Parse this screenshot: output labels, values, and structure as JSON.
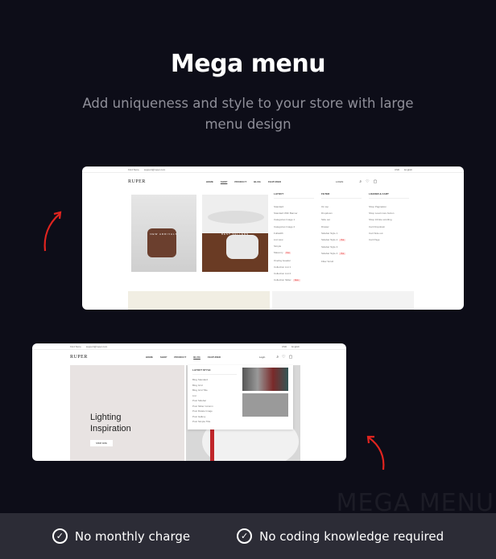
{
  "heading": {
    "title": "Mega menu",
    "subtitle": "Add uniqueness and style to your store with large menu design"
  },
  "watermark": "MEGA MENU",
  "features": [
    {
      "icon": "check-circle-icon",
      "label": "No monthly charge"
    },
    {
      "icon": "check-circle-icon",
      "label": "No coding knowledge required"
    }
  ],
  "shot1": {
    "topbar": {
      "store": "Find Store",
      "email": "support@ruper.com",
      "currency": "USD",
      "language": "English"
    },
    "logo": "RUPER",
    "nav": [
      "HOME",
      "SHOP",
      "PRODUCT",
      "BLOG",
      "FEATURED"
    ],
    "login": "LOGIN",
    "banners": [
      "NEW ARRIVALS",
      "BEST SELLERS"
    ],
    "columns": [
      {
        "title": "LAYOUT",
        "items": [
          "Standard",
          "Standard With Banner",
          "Categories Image 1",
          "Categories Image 2",
          "Fullwidth",
          "List view",
          "Simple",
          "Masonry",
          "Overlay Header",
          "Collection List 1",
          "Collection List 2",
          "Collection Slider"
        ]
      },
      {
        "title": "FILTER",
        "items": [
          "On top",
          "Dropdown",
          "Side out",
          "Drawer",
          "Sidebar Style 1",
          "Sidebar Style 2",
          "Sidebar Style 3",
          "Sidebar Style 4",
          "Filter Scroll"
        ]
      },
      {
        "title": "LOADER & CART",
        "items": [
          "Shop Pagination",
          "Shop Load more button",
          "Shop Infinite scrolling",
          "Cart Dropdown",
          "Cart Side out",
          "Cart Page"
        ]
      }
    ],
    "badges": {
      "hot": "Hot",
      "new": "New"
    }
  },
  "shot2": {
    "topbar": {
      "store": "Find Store",
      "email": "support@ruper.com",
      "currency": "USD",
      "language": "English"
    },
    "logo": "RUPER",
    "nav": [
      "HOME",
      "SHOP",
      "PRODUCT",
      "BLOG",
      "FEATURED"
    ],
    "login": "Login",
    "hero": {
      "title_line1": "Lighting",
      "title_line2": "Inspiration",
      "button": "SHOP NOW"
    },
    "menu": {
      "title": "LAYOUT STYLE",
      "items": [
        "Blog Standard",
        "Blog Grid",
        "Blog Grid Title",
        "List",
        "Post Sidebar",
        "Post Slider Column",
        "Post Rotate Image",
        "Post Gallery",
        "Post Simple Title"
      ]
    }
  },
  "colors": {
    "background": "#0d0d18",
    "bar": "#2c2c36",
    "arrow": "#e0241f"
  }
}
